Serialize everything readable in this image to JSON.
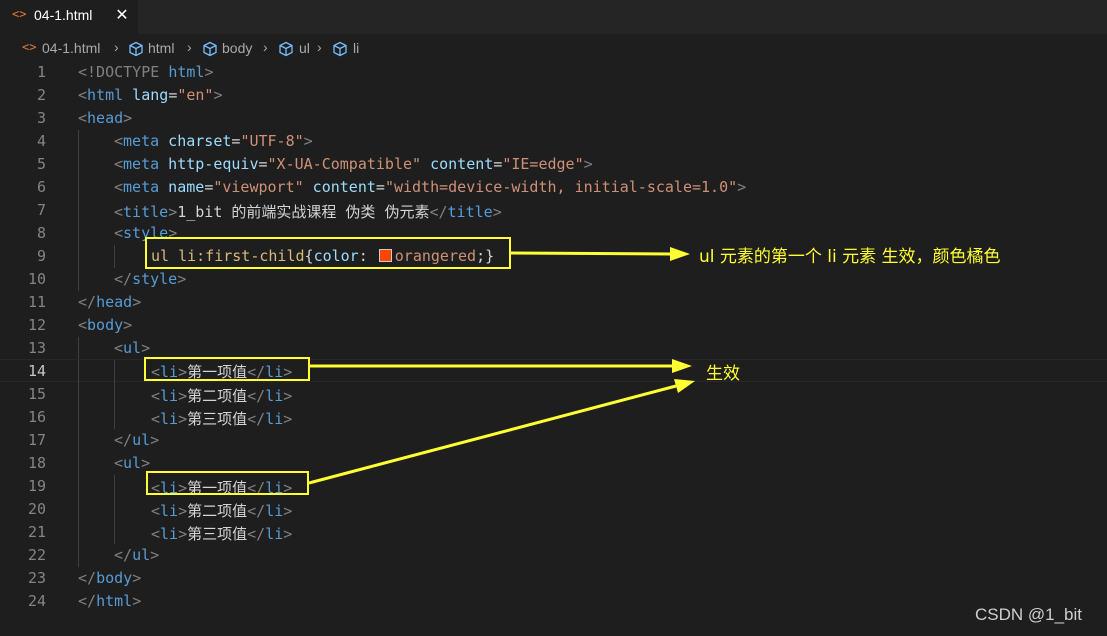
{
  "tab": {
    "icon": "html-file-icon",
    "name": "04-1.html",
    "close": "✕"
  },
  "breadcrumb": {
    "file": "04-1.html",
    "items": [
      "html",
      "body",
      "ul",
      "li"
    ]
  },
  "annotations": {
    "rule_note": "ul 元素的第一个 li 元素 生效，颜色橘色",
    "effect_note": "生效",
    "color": "#ffff33"
  },
  "colors": {
    "orangered": "#ff4500",
    "tag": "#569cd6",
    "attr": "#9cdcfe",
    "string": "#ce9178"
  },
  "code": {
    "ln": [
      "1",
      "2",
      "3",
      "4",
      "5",
      "6",
      "7",
      "8",
      "9",
      "10",
      "11",
      "12",
      "13",
      "14",
      "15",
      "16",
      "17",
      "18",
      "19",
      "20",
      "21",
      "22",
      "23",
      "24"
    ],
    "active_line": "14",
    "l1": {
      "open": "<!DOCTYPE ",
      "name": "html",
      "close": ">"
    },
    "l2": {
      "open": "<",
      "tag": "html",
      "attr": " lang",
      "eq": "=",
      "val": "\"en\"",
      "close": ">"
    },
    "l3": {
      "open": "<",
      "tag": "head",
      "close": ">"
    },
    "l4": {
      "open": "<",
      "tag": "meta",
      "attr": " charset",
      "eq": "=",
      "val": "\"UTF-8\"",
      "close": ">"
    },
    "l5": {
      "open": "<",
      "tag": "meta",
      "attr": " http-equiv",
      "eq": "=",
      "val": "\"X-UA-Compatible\"",
      "attr2": " content",
      "eq2": "=",
      "val2": "\"IE=edge\"",
      "close": ">"
    },
    "l6": {
      "open": "<",
      "tag": "meta",
      "attr": " name",
      "eq": "=",
      "val": "\"viewport\"",
      "attr2": " content",
      "eq2": "=",
      "val2": "\"width=device-width, initial-scale=1.0\"",
      "close": ">"
    },
    "l7": {
      "open": "<",
      "tag": "title",
      "close": ">",
      "text": "1_bit 的前端实战课程 伪类 伪元素",
      "open2": "</",
      "tag2": "title",
      "close2": ">"
    },
    "l8": {
      "open": "<",
      "tag": "style",
      "close": ">"
    },
    "l9": {
      "selector": "ul li:first-child",
      "brace_open": "{",
      "prop": "color",
      "colon": ": ",
      "value": "orangered",
      "end": ";}"
    },
    "l10": {
      "open": "</",
      "tag": "style",
      "close": ">"
    },
    "l11": {
      "open": "</",
      "tag": "head",
      "close": ">"
    },
    "l12": {
      "open": "<",
      "tag": "body",
      "close": ">"
    },
    "ul_open": {
      "open": "<",
      "tag": "ul",
      "close": ">"
    },
    "ul_close": {
      "open": "</",
      "tag": "ul",
      "close": ">"
    },
    "li": {
      "open": "<",
      "tag": "li",
      "close": ">",
      "open2": "</",
      "tag2": "li",
      "close2": ">"
    },
    "items": [
      "第一项值",
      "第二项值",
      "第三项值"
    ],
    "l23": {
      "open": "</",
      "tag": "body",
      "close": ">"
    },
    "l24": {
      "open": "</",
      "tag": "html",
      "close": ">"
    }
  },
  "watermark": "CSDN @1_bit"
}
